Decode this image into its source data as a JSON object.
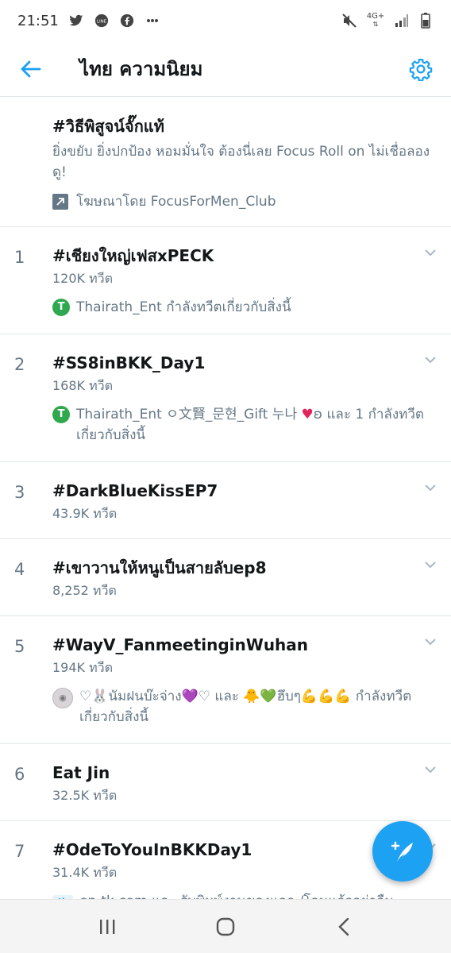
{
  "status_bar": {
    "time": "21:51",
    "app_icons": [
      "twitter-icon",
      "line-icon",
      "facebook-icon",
      "more-dots-icon"
    ],
    "network": "4G+",
    "system_icons": [
      "mute-icon",
      "network-4g-icon",
      "signal-icon",
      "battery-icon"
    ]
  },
  "header": {
    "title": "ไทย ความนิยม",
    "accent_color": "#1da1f2"
  },
  "promoted": {
    "title": "#วิธีพิสูจน์จั๊กแท้",
    "description": "ยิ่งขยับ ยิ่งปกป้อง หอมมั่นใจ ต้องนี่เลย Focus Roll on ไม่เชื่อลองดู!",
    "promoted_by": "โฆษณาโดย FocusForMen_Club"
  },
  "trends": [
    {
      "rank": "1",
      "title": "#เชียงใหญ่เฟสxPECK",
      "count": "120K ทวีต",
      "context": "Thairath_Ent กำลังทวีตเกี่ยวกับสิ่งนี้",
      "avatar": "T"
    },
    {
      "rank": "2",
      "title": "#SS8inBKK_Day1",
      "count": "168K ทวีต",
      "context_part1": "Thairath_Ent ㅇ文賢_문현_Gift 누나 ",
      "context_heart": "♥",
      "context_part2": "ʚ และ 1 กำลังทวีตเกี่ยวกับสิ่งนี้",
      "avatar": "T"
    },
    {
      "rank": "3",
      "title": "#DarkBlueKissEP7",
      "count": "43.9K ทวีต"
    },
    {
      "rank": "4",
      "title": "#เขาวานให้หนูเป็นสายลับep8",
      "count": "8,252 ทวีต"
    },
    {
      "rank": "5",
      "title": "#WayV_FanmeetinginWuhan",
      "count": "194K ทวีต",
      "context": "♡🐰นัมฝนบ๊ะจ่าง💜♡ และ 🐥💚ฮึบๆ💪💪💪 กำลังทวีตเกี่ยวกับสิ่งนี้"
    },
    {
      "rank": "6",
      "title": "Eat Jin",
      "count": "32.5K ทวีต"
    },
    {
      "rank": "7",
      "title": "#OdeToYouInBKKDay1",
      "count": "31.4K ทวีต",
      "context": "en-tk.com และ รับพิมพ์งานของแจก /โอนแล้วอย่าลืม"
    }
  ],
  "nav": {
    "recents": "recents-icon",
    "home": "home-icon",
    "back": "back-icon"
  }
}
